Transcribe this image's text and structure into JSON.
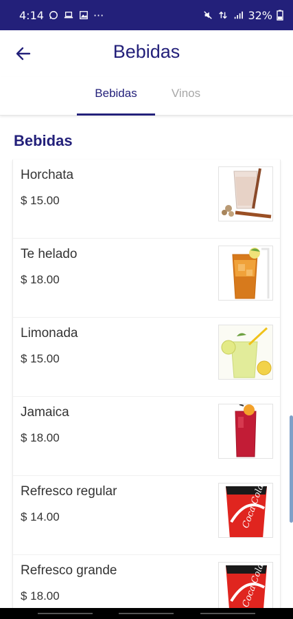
{
  "status": {
    "time": "4:14",
    "dots": "···",
    "battery": "32%"
  },
  "header": {
    "title": "Bebidas",
    "back_icon": "arrow-left-icon"
  },
  "tabs": [
    {
      "label": "Bebidas",
      "active": true
    },
    {
      "label": "Vinos",
      "active": false
    }
  ],
  "section": {
    "title": "Bebidas"
  },
  "items": [
    {
      "name": "Horchata",
      "price": "$ 15.00",
      "image": "horchata-drink"
    },
    {
      "name": "Te helado",
      "price": "$ 18.00",
      "image": "iced-tea-drink"
    },
    {
      "name": "Limonada",
      "price": "$ 15.00",
      "image": "lemonade-drink"
    },
    {
      "name": "Jamaica",
      "price": "$ 18.00",
      "image": "jamaica-drink"
    },
    {
      "name": "Refresco regular",
      "price": "$ 14.00",
      "image": "soda-cup"
    },
    {
      "name": "Refresco grande",
      "price": "$ 18.00",
      "image": "soda-cup-large"
    }
  ],
  "colors": {
    "primary": "#23207a",
    "inactive_tab": "#a7a7a7"
  }
}
